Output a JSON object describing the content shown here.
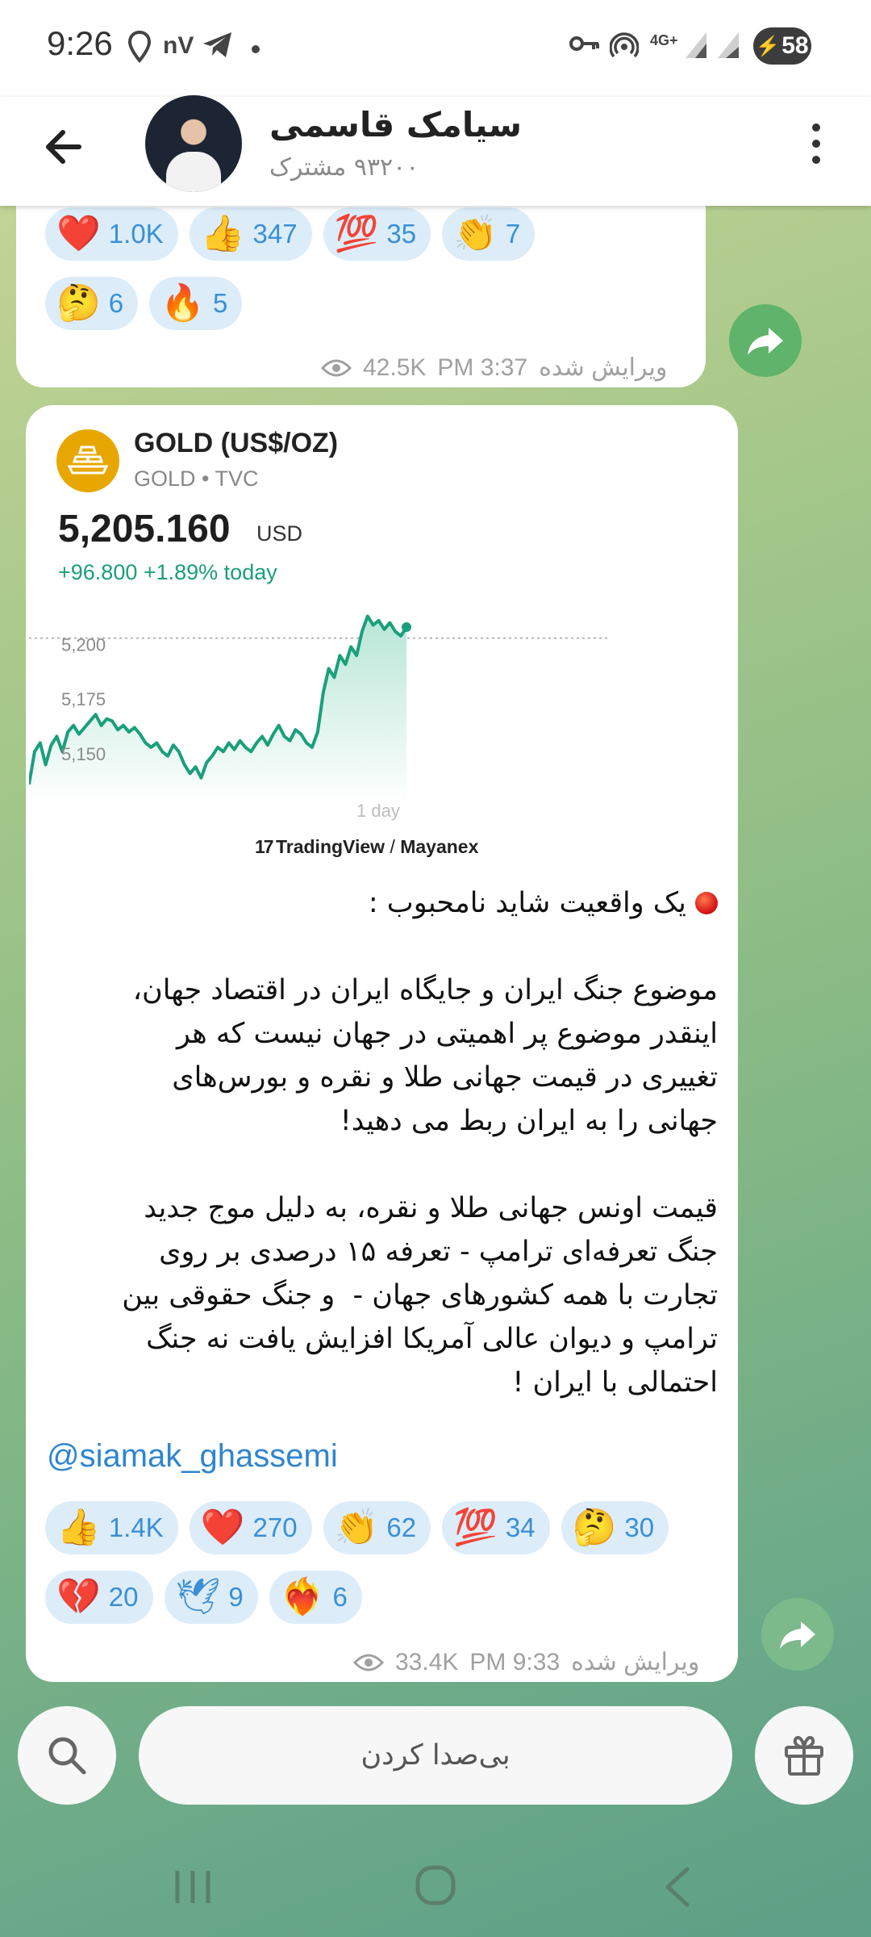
{
  "status_bar": {
    "time": "9:26",
    "network": "4G+",
    "battery": "58"
  },
  "header": {
    "channel_name": "سیامک قاسمی",
    "subscribers": "۹۳۲۰۰ مشترک"
  },
  "post1": {
    "reactions": [
      {
        "emoji": "❤️",
        "count": "1.0K"
      },
      {
        "emoji": "👍",
        "count": "347"
      },
      {
        "emoji": "💯",
        "count": "35"
      },
      {
        "emoji": "👏",
        "count": "7"
      },
      {
        "emoji": "🤔",
        "count": "6"
      },
      {
        "emoji": "🔥",
        "count": "5"
      }
    ],
    "views": "42.5K",
    "time": "PM 3:37",
    "edited": "ویرایش شده"
  },
  "post2": {
    "card": {
      "title": "GOLD (US$/OZ)",
      "subtitle": "GOLD • TVC",
      "price": "5,205.160",
      "currency": "USD",
      "change": "+96.800 +1.89% today",
      "period": "1 day",
      "source_brand": "TradingView",
      "source_sep": "/",
      "source_partner": "Mayanex"
    },
    "chart_data": {
      "type": "area",
      "title": "GOLD (US$/OZ)",
      "xlabel": "1 day",
      "ylabel": "",
      "yticks": [
        "5,200",
        "5,175",
        "5,150"
      ],
      "ylim": [
        5130,
        5215
      ],
      "reference_line": 5200,
      "color": "#1a9f7a",
      "values": [
        5133,
        5148,
        5152,
        5142,
        5151,
        5155,
        5148,
        5157,
        5160,
        5156,
        5159,
        5162,
        5165,
        5160,
        5163,
        5162,
        5158,
        5160,
        5157,
        5159,
        5156,
        5152,
        5150,
        5152,
        5148,
        5146,
        5151,
        5148,
        5142,
        5138,
        5141,
        5136,
        5143,
        5146,
        5150,
        5148,
        5152,
        5149,
        5153,
        5150,
        5148,
        5152,
        5155,
        5151,
        5156,
        5160,
        5155,
        5153,
        5158,
        5156,
        5152,
        5150,
        5157,
        5175,
        5186,
        5182,
        5192,
        5188,
        5196,
        5192,
        5203,
        5210,
        5206,
        5208,
        5204,
        5207,
        5203,
        5201,
        5205
      ]
    },
    "text": {
      "headline": " یک واقعیت شاید نامحبوب :",
      "paragraph1": "موضوع جنگ ایران و جایگاه ایران در اقتصاد جهان،\nاینقدر موضوع پر اهمیتی در جهان نیست که هر\nتغییری در قیمت جهانی طلا و نقره و بورس‌های\nجهانی را به ایران ربط می دهید!",
      "paragraph2": "قیمت اونس جهانی طلا و نقره، به دلیل موج جدید\nجنگ تعرفه‌ای ترامپ - تعرفه ۱۵ درصدی بر روی\nتجارت با همه کشورهای جهان -  و جنگ حقوقی بین\nترامپ و دیوان عالی آمریکا افزایش یافت نه جنگ\nاحتمالی با ایران !"
    },
    "link": "@siamak_ghassemi",
    "reactions": [
      {
        "emoji": "👍",
        "count": "1.4K"
      },
      {
        "emoji": "❤️",
        "count": "270"
      },
      {
        "emoji": "👏",
        "count": "62"
      },
      {
        "emoji": "💯",
        "count": "34"
      },
      {
        "emoji": "🤔",
        "count": "30"
      },
      {
        "emoji": "💔",
        "count": "20"
      },
      {
        "emoji": "🕊",
        "count": "9"
      },
      {
        "emoji": "❤️‍🔥",
        "count": "6"
      }
    ],
    "views": "33.4K",
    "time": "PM 9:33",
    "edited": "ویرایش شده"
  },
  "bottom_bar": {
    "mute_label": "بی‌صدا کردن"
  },
  "colors": {
    "accent": "#3a8fd6",
    "share_green": "#5fb36a",
    "chart_line": "#1a9f7a"
  }
}
